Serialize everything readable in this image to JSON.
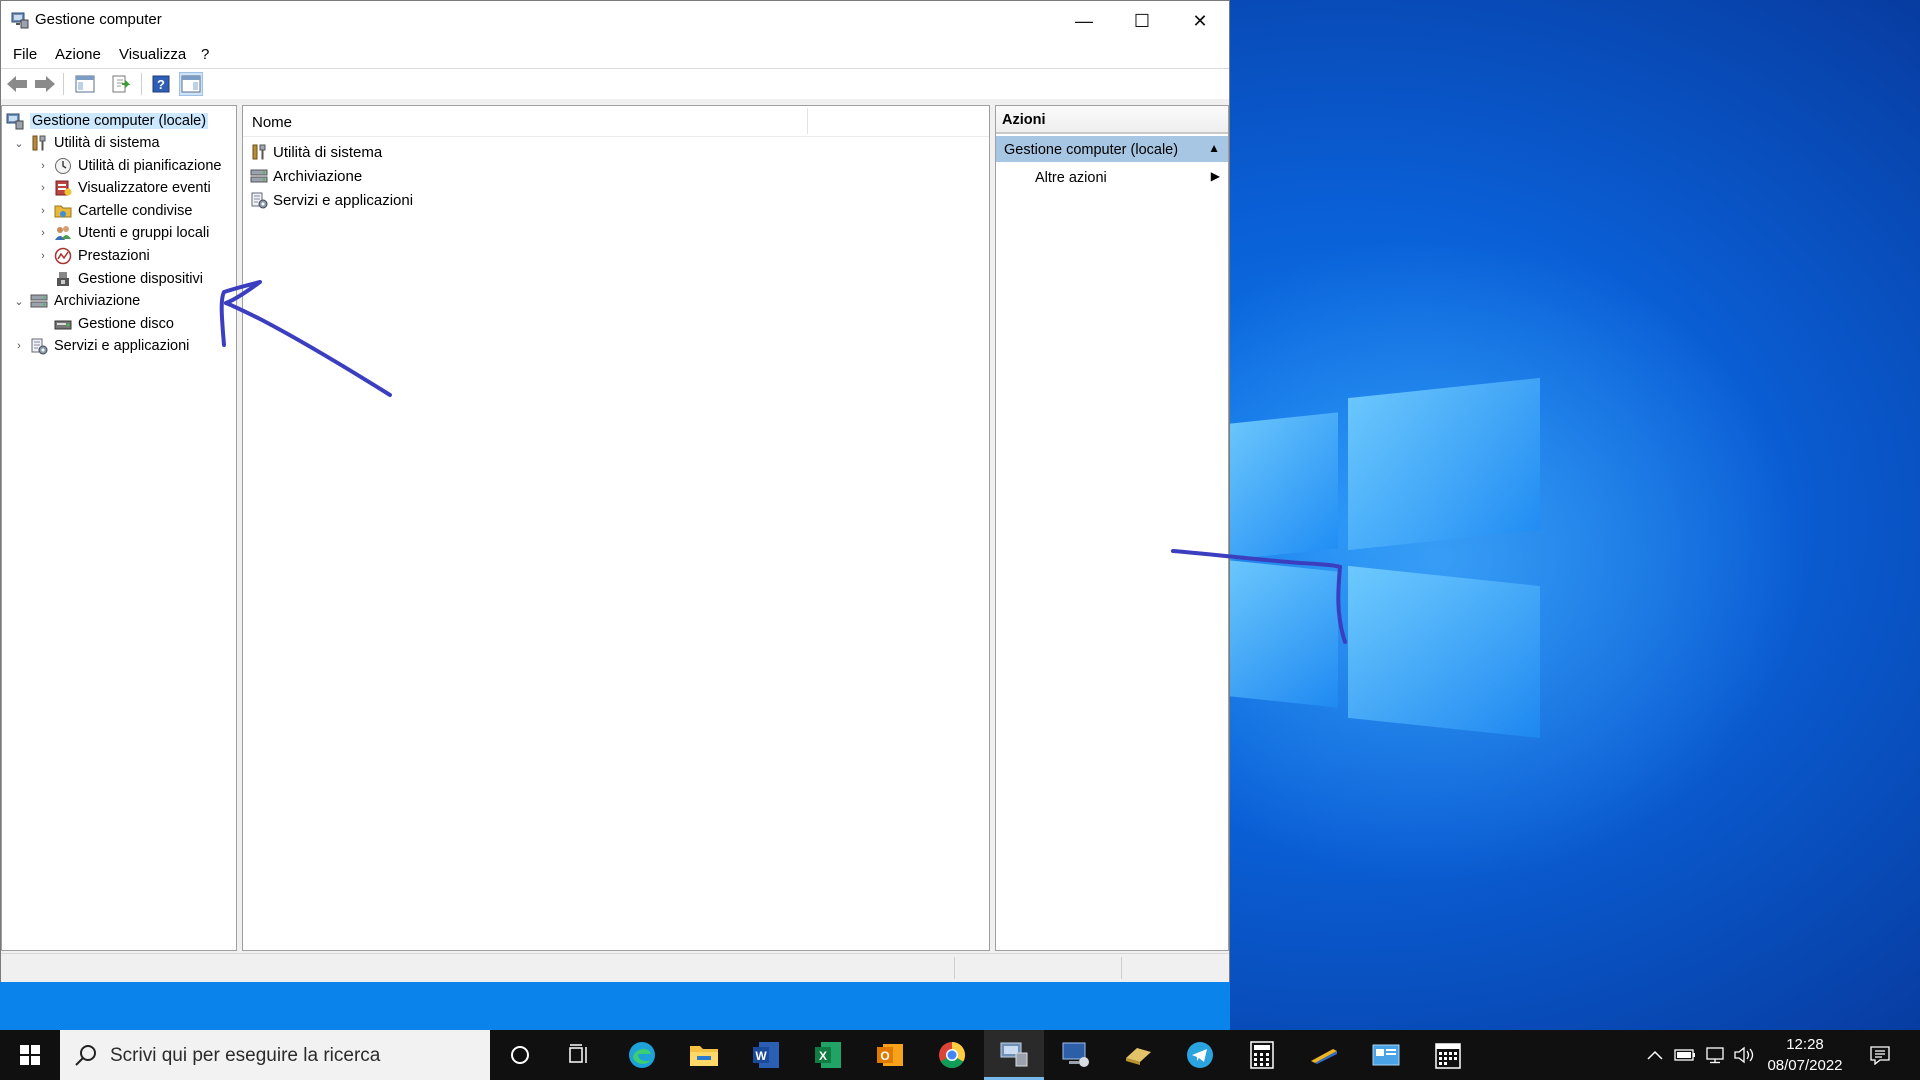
{
  "window": {
    "title": "Gestione computer",
    "controls": {
      "minimize": "—",
      "maximize": "☐",
      "close": "✕"
    }
  },
  "menu": [
    "File",
    "Azione",
    "Visualizza",
    "?"
  ],
  "toolbar": {
    "icons": [
      "back-icon",
      "forward-icon",
      "show-hide-console-tree-icon",
      "export-list-icon",
      "help-icon",
      "show-hide-action-pane-icon"
    ]
  },
  "tree": {
    "root": "Gestione computer (locale)",
    "items": [
      {
        "label": "Utilità di sistema",
        "expander": "⌄",
        "icon": "tools-icon"
      },
      {
        "label": "Utilità di pianificazione",
        "expander": "›",
        "icon": "clock-icon"
      },
      {
        "label": "Visualizzatore eventi",
        "expander": "›",
        "icon": "event-viewer-icon"
      },
      {
        "label": "Cartelle condivise",
        "expander": "›",
        "icon": "shared-folder-icon"
      },
      {
        "label": "Utenti e gruppi locali",
        "expander": "›",
        "icon": "users-icon"
      },
      {
        "label": "Prestazioni",
        "expander": "›",
        "icon": "performance-icon"
      },
      {
        "label": "Gestione dispositivi",
        "expander": "",
        "icon": "device-manager-icon"
      },
      {
        "label": "Archiviazione",
        "expander": "⌄",
        "icon": "storage-icon"
      },
      {
        "label": "Gestione disco",
        "expander": "",
        "icon": "disk-icon"
      },
      {
        "label": "Servizi e applicazioni",
        "expander": "›",
        "icon": "services-icon"
      }
    ]
  },
  "list": {
    "column_name": "Nome",
    "items": [
      {
        "label": "Utilità di sistema",
        "icon": "tools-icon"
      },
      {
        "label": "Archiviazione",
        "icon": "storage-icon"
      },
      {
        "label": "Servizi e applicazioni",
        "icon": "services-icon"
      }
    ]
  },
  "actions": {
    "title": "Azioni",
    "section": "Gestione computer (locale)",
    "section_arrow": "▲",
    "more": "Altre azioni",
    "more_arrow": "▶"
  },
  "taskbar": {
    "search_placeholder": "Scrivi qui per eseguire la ricerca",
    "apps": [
      "cortana-icon",
      "task-view-icon",
      "edge-icon",
      "file-explorer-icon",
      "word-icon",
      "excel-icon",
      "outlook-icon",
      "chrome-icon",
      "computer-management-icon",
      "remote-desktop-icon",
      "eraser-icon",
      "telegram-icon",
      "calculator-icon",
      "pen-icon",
      "control-panel-icon",
      "calendar-icon"
    ],
    "tray_icons": [
      "show-hidden-icons-icon",
      "battery-icon",
      "network-icon",
      "volume-icon",
      "notifications-icon"
    ],
    "time": "12:28",
    "date": "08/07/2022"
  },
  "colors": {
    "selection": "#cce8ff",
    "actions_section": "#a7c6e4",
    "annotation_ink": "#3b3fbf",
    "desktop_blue": "#0a5fd6"
  }
}
